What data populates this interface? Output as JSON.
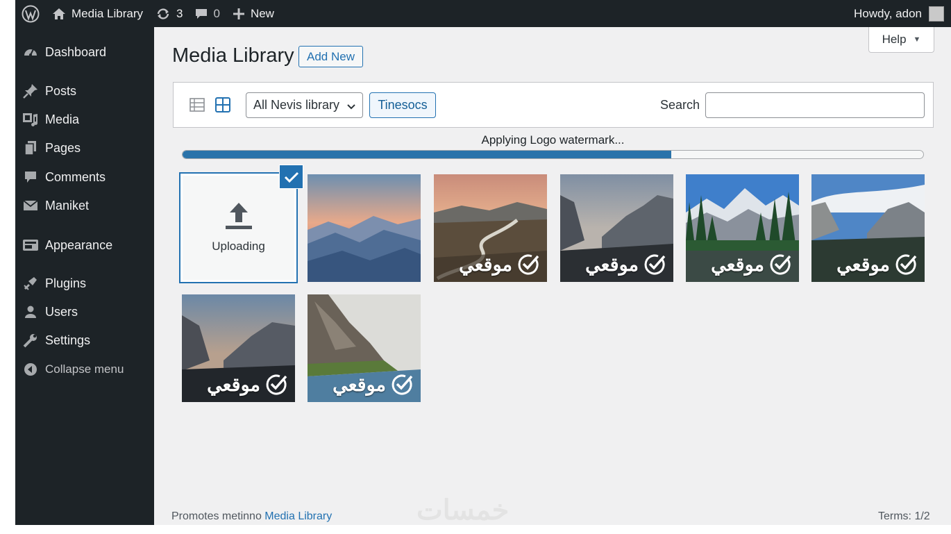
{
  "admin_bar": {
    "wp_logo": "wordpress-icon",
    "site_name": "Media Library",
    "updates_count": "3",
    "comments_count": "0",
    "new_label": "New",
    "greeting": "Howdy, adon"
  },
  "sidebar": {
    "items": [
      {
        "label": "Dashboard",
        "icon": "dashboard-icon"
      },
      {
        "label": "Posts",
        "icon": "pin-icon"
      },
      {
        "label": "Media",
        "icon": "media-icon"
      },
      {
        "label": "Pages",
        "icon": "pages-icon"
      },
      {
        "label": "Comments",
        "icon": "comment-icon"
      },
      {
        "label": "Maniket",
        "icon": "envelope-icon"
      },
      {
        "label": "Appearance",
        "icon": "appearance-icon"
      },
      {
        "label": "Plugins",
        "icon": "plugin-icon"
      },
      {
        "label": "Users",
        "icon": "user-icon"
      },
      {
        "label": "Settings",
        "icon": "wrench-icon"
      },
      {
        "label": "Collapse menu",
        "icon": "collapse-icon"
      }
    ]
  },
  "help": {
    "label": "Help",
    "caret": "▼"
  },
  "page": {
    "title": "Media Library",
    "add_new_label": "Add New"
  },
  "toolbar": {
    "filter_value": "All Nevis library",
    "filter_button": "Tinesocs",
    "search_label": "Search",
    "search_value": ""
  },
  "progress": {
    "label": "Applying Logo watermark...",
    "fraction": 0.66
  },
  "grid": {
    "upload_label": "Uploading",
    "watermark_text": "موقعي",
    "items": [
      {
        "watermarked": false,
        "scene": "sunset-ridges"
      },
      {
        "watermarked": true,
        "scene": "river-valley"
      },
      {
        "watermarked": true,
        "scene": "granite-valley"
      },
      {
        "watermarked": true,
        "scene": "forest-lake"
      },
      {
        "watermarked": true,
        "scene": "valley-clouds"
      },
      {
        "watermarked": true,
        "scene": "dusk-cliffs"
      },
      {
        "watermarked": true,
        "scene": "cliff-lake"
      }
    ]
  },
  "footer": {
    "prefix": "Promotes metinno",
    "link": "Media Library",
    "terms": "Terms: 1/2",
    "site_mark": "خمسات"
  },
  "colors": {
    "accent": "#2271b1",
    "admin_bg": "#1d2327",
    "content_bg": "#f0f0f1"
  }
}
